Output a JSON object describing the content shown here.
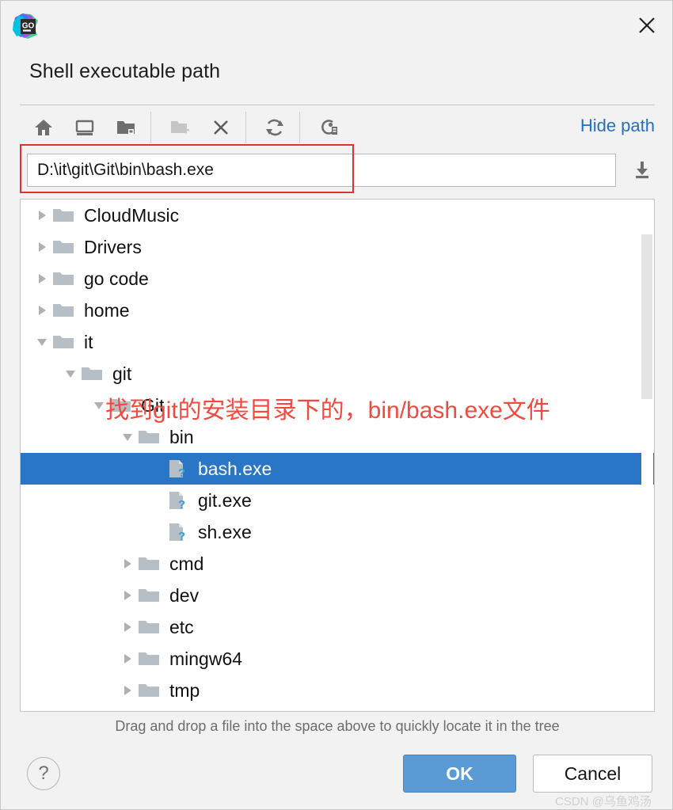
{
  "window": {
    "app_icon": "goland-logo-icon",
    "close_icon": "close-icon",
    "heading": "Shell executable path"
  },
  "toolbar": {
    "buttons": [
      {
        "name": "home-icon",
        "title": "Home"
      },
      {
        "name": "desktop-icon",
        "title": "Desktop"
      },
      {
        "name": "project-folder-icon",
        "title": "Project Directory"
      },
      {
        "name": "new-folder-icon",
        "title": "New Folder"
      },
      {
        "name": "delete-icon",
        "title": "Delete"
      },
      {
        "name": "refresh-icon",
        "title": "Refresh"
      },
      {
        "name": "show-hidden-icon",
        "title": "Show Hidden Files"
      }
    ],
    "hide_path_label": "Hide path"
  },
  "path": {
    "value": "D:\\it\\git\\Git\\bin\\bash.exe",
    "placeholder": "",
    "save_icon": "download-icon",
    "highlight_color": "#e03030"
  },
  "tree": {
    "rows": [
      {
        "label": "CloudMusic",
        "depth": 1,
        "twisty": "collapsed",
        "icon": "folder-icon",
        "selected": false
      },
      {
        "label": "Drivers",
        "depth": 1,
        "twisty": "collapsed",
        "icon": "folder-icon",
        "selected": false
      },
      {
        "label": "go code",
        "depth": 1,
        "twisty": "collapsed",
        "icon": "folder-icon",
        "selected": false
      },
      {
        "label": "home",
        "depth": 1,
        "twisty": "collapsed",
        "icon": "folder-icon",
        "selected": false
      },
      {
        "label": "it",
        "depth": 1,
        "twisty": "expanded",
        "icon": "folder-icon",
        "selected": false
      },
      {
        "label": "git",
        "depth": 2,
        "twisty": "expanded",
        "icon": "folder-icon",
        "selected": false
      },
      {
        "label": "Git",
        "depth": 3,
        "twisty": "expanded",
        "icon": "folder-icon",
        "selected": false
      },
      {
        "label": "bin",
        "depth": 4,
        "twisty": "expanded",
        "icon": "folder-icon",
        "selected": false
      },
      {
        "label": "bash.exe",
        "depth": 5,
        "twisty": "none",
        "icon": "unknown-file-icon",
        "selected": true
      },
      {
        "label": "git.exe",
        "depth": 5,
        "twisty": "none",
        "icon": "unknown-file-icon",
        "selected": false
      },
      {
        "label": "sh.exe",
        "depth": 5,
        "twisty": "none",
        "icon": "unknown-file-icon",
        "selected": false
      },
      {
        "label": "cmd",
        "depth": 4,
        "twisty": "collapsed",
        "icon": "folder-icon",
        "selected": false
      },
      {
        "label": "dev",
        "depth": 4,
        "twisty": "collapsed",
        "icon": "folder-icon",
        "selected": false
      },
      {
        "label": "etc",
        "depth": 4,
        "twisty": "collapsed",
        "icon": "folder-icon",
        "selected": false
      },
      {
        "label": "mingw64",
        "depth": 4,
        "twisty": "collapsed",
        "icon": "folder-icon",
        "selected": false
      },
      {
        "label": "tmp",
        "depth": 4,
        "twisty": "collapsed",
        "icon": "folder-icon",
        "selected": false
      }
    ],
    "selection_color": "#2a76c6"
  },
  "annotation": {
    "text": "找到git的安装目录下的，bin/bash.exe文件",
    "color": "#f4493f"
  },
  "footer": {
    "hint": "Drag and drop a file into the space above to quickly locate it in the tree",
    "help_label": "?",
    "ok_label": "OK",
    "cancel_label": "Cancel",
    "ok_color": "#5b9bd5"
  },
  "watermark": {
    "text": "CSDN @乌鱼鸡汤"
  }
}
